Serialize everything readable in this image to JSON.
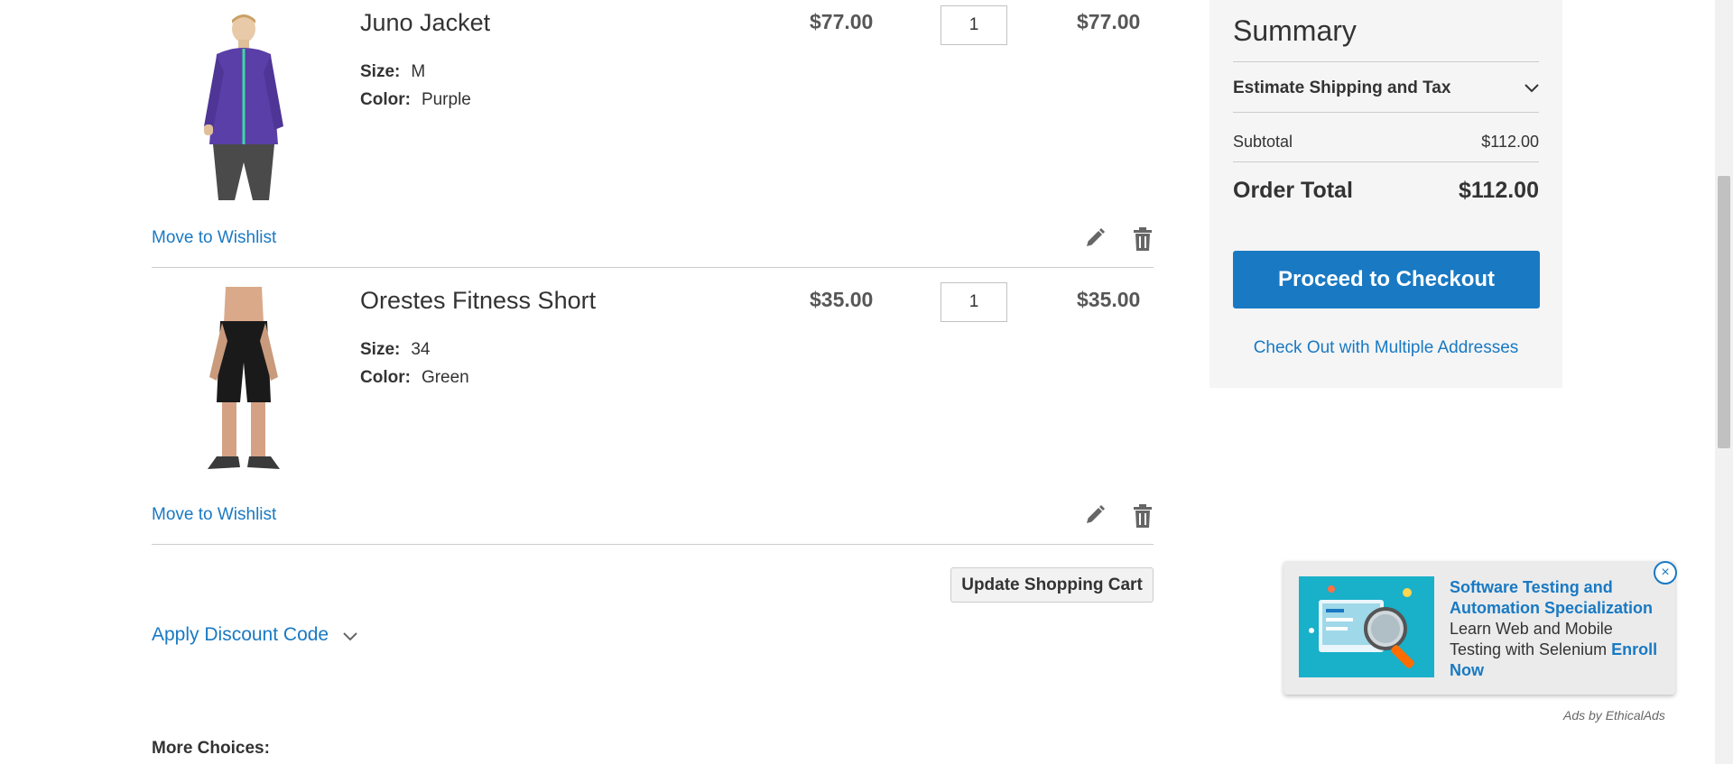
{
  "cart": {
    "items": [
      {
        "name": "Juno Jacket",
        "size_label": "Size:",
        "size_value": "M",
        "color_label": "Color:",
        "color_value": "Purple",
        "price": "$77.00",
        "qty": "1",
        "subtotal": "$77.00",
        "wishlist_label": "Move to Wishlist"
      },
      {
        "name": "Orestes Fitness Short",
        "size_label": "Size:",
        "size_value": "34",
        "color_label": "Color:",
        "color_value": "Green",
        "price": "$35.00",
        "qty": "1",
        "subtotal": "$35.00",
        "wishlist_label": "Move to Wishlist"
      }
    ],
    "update_button": "Update Shopping Cart",
    "discount_label": "Apply Discount Code",
    "more_choices_label": "More Choices:"
  },
  "summary": {
    "title": "Summary",
    "shipping_label": "Estimate Shipping and Tax",
    "subtotal_label": "Subtotal",
    "subtotal_value": "$112.00",
    "total_label": "Order Total",
    "total_value": "$112.00",
    "checkout_button": "Proceed to Checkout",
    "multi_address_link": "Check Out with Multiple Addresses"
  },
  "ad": {
    "title": "Software Testing and Automation Specialization",
    "body": "Learn Web and Mobile Testing with Selenium",
    "cta": "Enroll Now",
    "close": "×",
    "credit": "Ads by EthicalAds"
  },
  "colors": {
    "link": "#1979c3",
    "primary_button": "#1979c3",
    "summary_bg": "#f5f5f5",
    "jacket": "#5a3fa8",
    "shorts": "#1a1a1a"
  },
  "icons": [
    "pencil-icon",
    "trash-icon",
    "chevron-down-icon",
    "close-icon"
  ]
}
